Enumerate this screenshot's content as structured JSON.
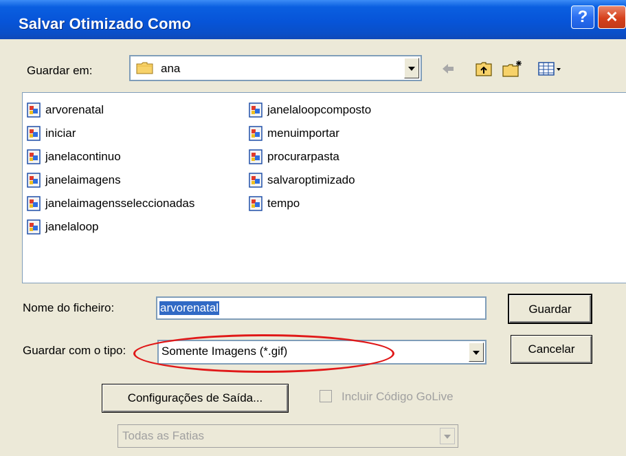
{
  "window": {
    "title": "Salvar Otimizado Como"
  },
  "titlebar": {
    "help_glyph": "?",
    "close_glyph": "✕"
  },
  "lookin": {
    "label": "Guardar em:",
    "folder": "ana",
    "folder_icon": "folder-icon"
  },
  "toolbar": {
    "icons": [
      "back-arrow-icon",
      "up-folder-icon",
      "new-folder-icon",
      "view-menu-icon"
    ]
  },
  "files": [
    {
      "name": "arvorenatal",
      "icon": "image-file-icon"
    },
    {
      "name": "iniciar",
      "icon": "image-file-icon"
    },
    {
      "name": "janelacontinuo",
      "icon": "image-file-icon"
    },
    {
      "name": "janelaimagens",
      "icon": "image-file-icon"
    },
    {
      "name": "janelaimagensseleccionadas",
      "icon": "image-file-icon"
    },
    {
      "name": "janelaloop",
      "icon": "image-file-icon"
    },
    {
      "name": "janelaloopcomposto",
      "icon": "image-file-icon"
    },
    {
      "name": "menuimportar",
      "icon": "image-file-icon"
    },
    {
      "name": "procurarpasta",
      "icon": "image-file-icon"
    },
    {
      "name": "salvaroptimizado",
      "icon": "image-file-icon"
    },
    {
      "name": "tempo",
      "icon": "image-file-icon"
    }
  ],
  "filename": {
    "label": "Nome do ficheiro:",
    "value": "arvorenatal"
  },
  "filetype": {
    "label": "Guardar com o tipo:",
    "value": "Somente Imagens (*.gif)"
  },
  "buttons": {
    "save": "Guardar",
    "cancel": "Cancelar",
    "output_settings": "Configurações de Saída..."
  },
  "golive": {
    "label": "Incluir Código GoLive",
    "checked": false
  },
  "slices": {
    "value": "Todas as Fatias"
  },
  "colors": {
    "highlight": "#e01818",
    "selection": "#316ac5",
    "titlebar": "#0754d8"
  }
}
